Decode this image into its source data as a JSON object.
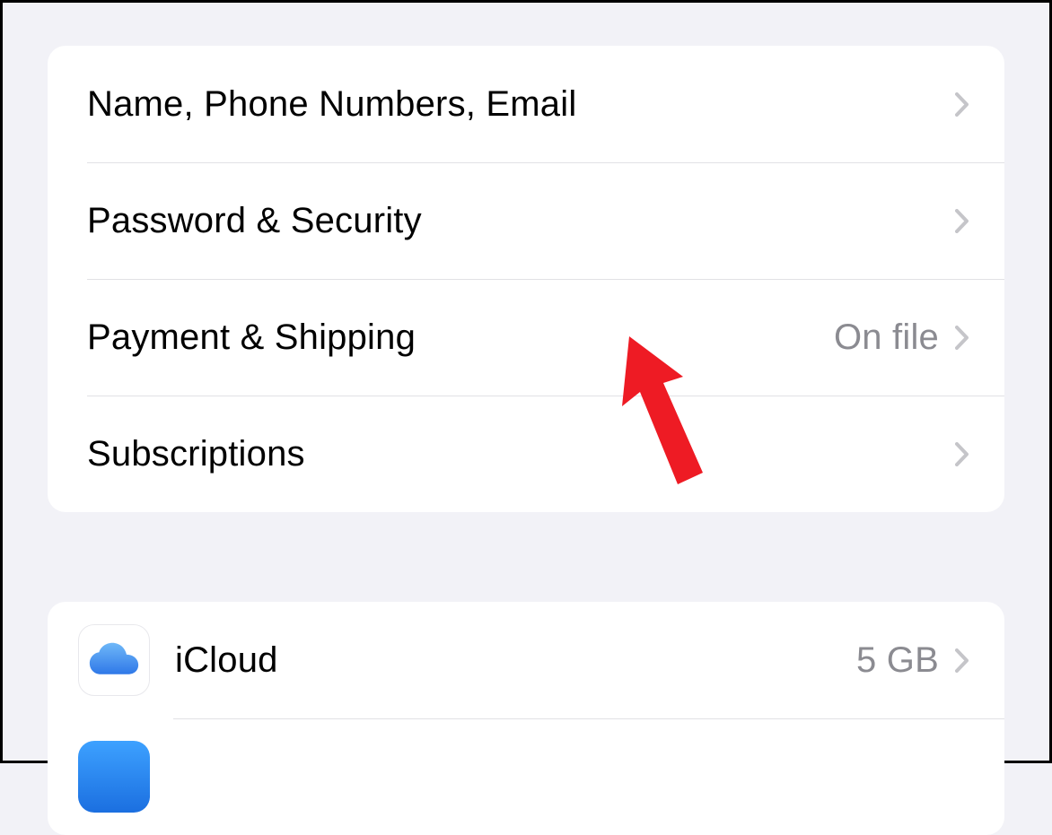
{
  "group1": {
    "items": [
      {
        "label": "Name, Phone Numbers, Email",
        "detail": ""
      },
      {
        "label": "Password & Security",
        "detail": ""
      },
      {
        "label": "Payment & Shipping",
        "detail": "On file"
      },
      {
        "label": "Subscriptions",
        "detail": ""
      }
    ]
  },
  "group2": {
    "items": [
      {
        "label": "iCloud",
        "detail": "5 GB",
        "icon": "cloud"
      }
    ]
  }
}
